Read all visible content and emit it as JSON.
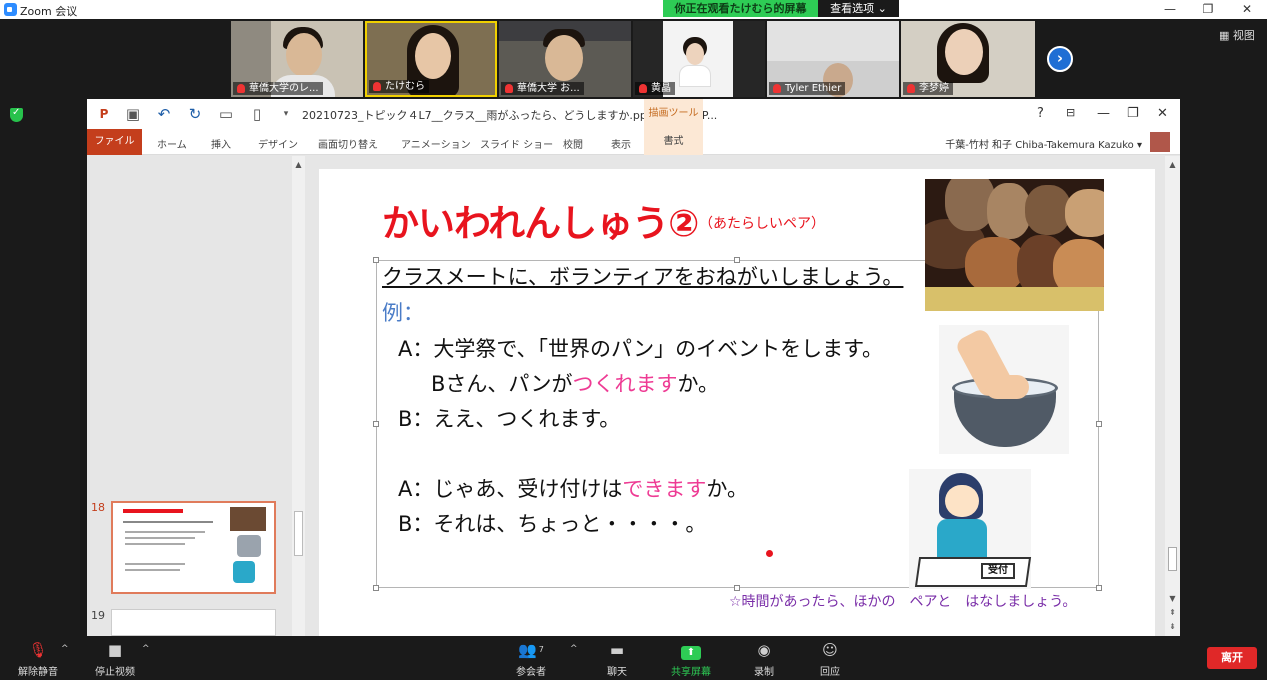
{
  "window": {
    "title": "Zoom 会议",
    "minimize": "—",
    "restore": "❐",
    "close": "✕"
  },
  "share_banner": {
    "viewing": "你正在观看たけむら的屏幕",
    "options": "查看选项 ⌄"
  },
  "participants": [
    {
      "name": "華僑大学のレ..."
    },
    {
      "name": "たけむら"
    },
    {
      "name": "華僑大学 お..."
    },
    {
      "name": "黄晶"
    },
    {
      "name": "Tyler Ethier"
    },
    {
      "name": "李梦婷"
    }
  ],
  "view_label": "视图",
  "next_arrow": "›",
  "ppt": {
    "doc_title": "20210723_トピック４L7__クラス__雨がふったら、どうしますか.pptx - PowerP...",
    "drawing_tools": "描画ツール",
    "win_help": "?",
    "win_min": "—",
    "win_restore": "❐",
    "win_close": "✕",
    "tabs": [
      "ファイル",
      "ホーム",
      "挿入",
      "デザイン",
      "画面切り替え",
      "アニメーション",
      "スライド ショー",
      "校閲",
      "表示",
      "書式"
    ],
    "user": "千葉-竹村 和子 Chiba-Takemura Kazuko ▾",
    "slide_numbers": [
      "18",
      "19"
    ]
  },
  "slide": {
    "title": "かいわれんしゅう②",
    "subtitle": "（あたらしいペア）",
    "instruction": "クラスメートに、ボランティアをおねがいしましょう。",
    "example_label": "例：",
    "line1": "A：大学祭で、「世界のパン」のイベントをします。",
    "line2_pre": "Bさん、パンが",
    "line2_pink": "つくれます",
    "line2_post": "か。",
    "line3": "B：ええ、つくれます。",
    "line4_pre": "A：じゃあ、受け付けは",
    "line4_pink": "できます",
    "line4_post": "か。",
    "line5": "B：それは、ちょっと・・・・。",
    "footer": "☆時間があったら、ほかの　ペアと　はなしましょう。",
    "desk_sign": "受付"
  },
  "toolbar": {
    "mute": "解除静音",
    "video": "停止视频",
    "participants": "参会者",
    "participant_count": "7",
    "chat": "聊天",
    "share": "共享屏幕",
    "record": "录制",
    "reactions": "回应",
    "leave": "离开"
  }
}
